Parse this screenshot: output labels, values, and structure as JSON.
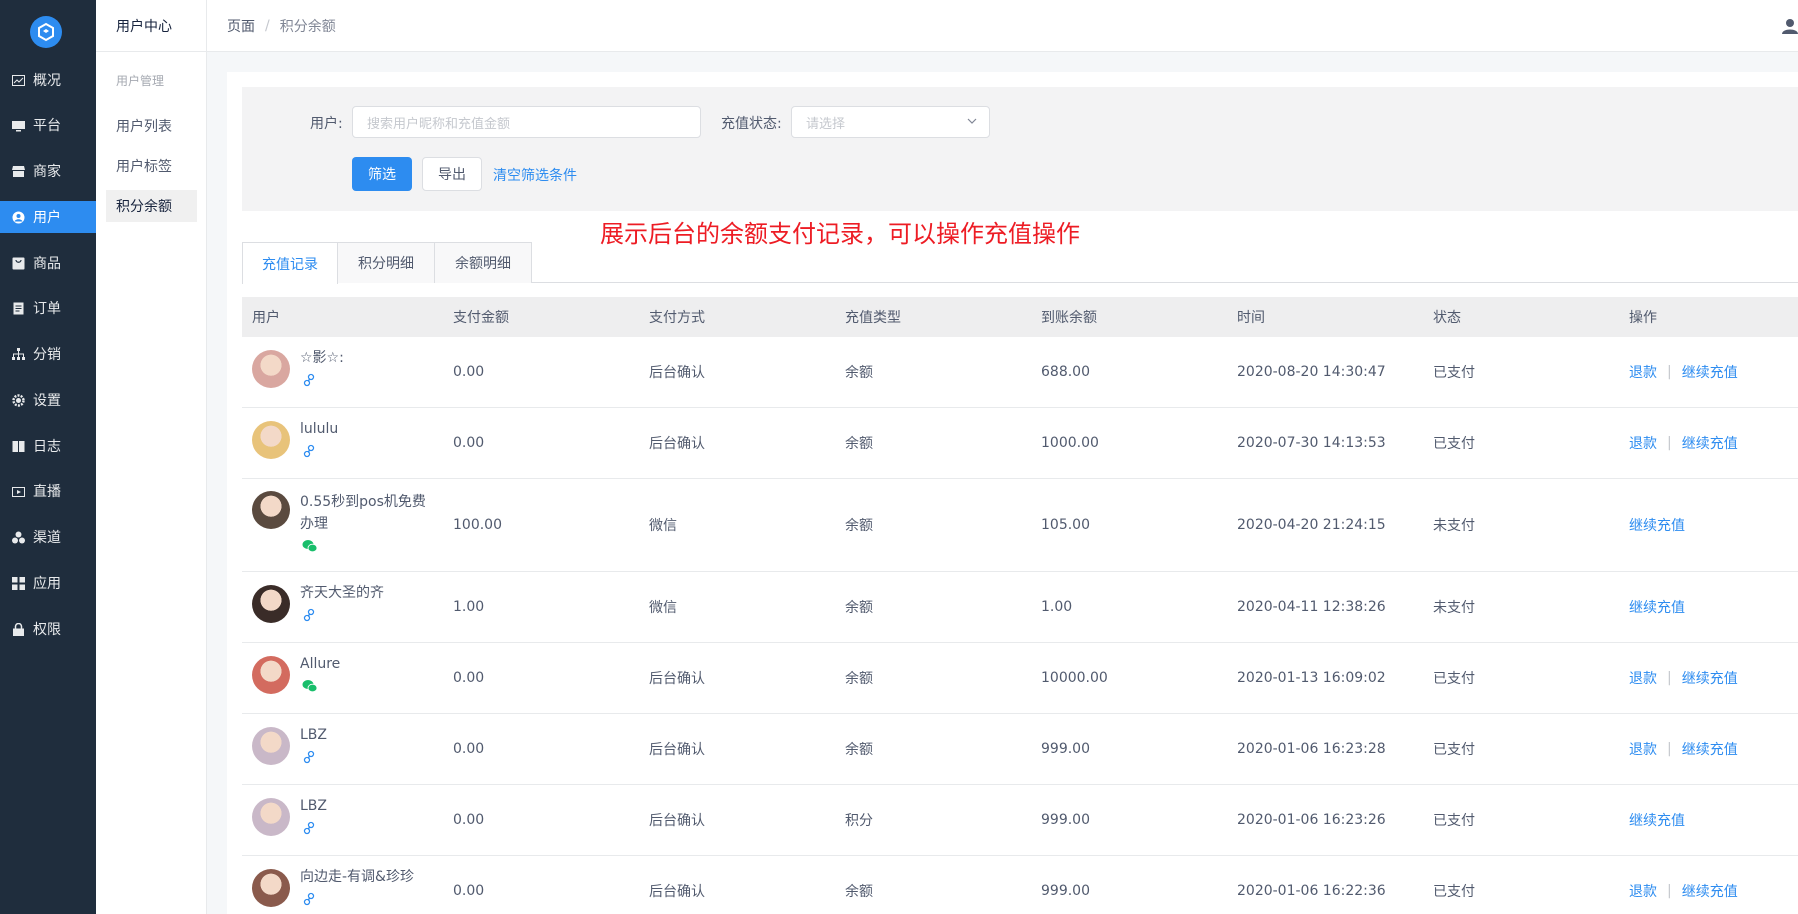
{
  "nav": {
    "items": [
      {
        "label": "概况",
        "icon": "dashboard-icon"
      },
      {
        "label": "平台",
        "icon": "monitor-icon"
      },
      {
        "label": "商家",
        "icon": "store-icon"
      },
      {
        "label": "用户",
        "icon": "user-icon",
        "active": true
      },
      {
        "label": "商品",
        "icon": "goods-icon"
      },
      {
        "label": "订单",
        "icon": "order-icon"
      },
      {
        "label": "分销",
        "icon": "distribution-icon"
      },
      {
        "label": "设置",
        "icon": "gear-icon"
      },
      {
        "label": "日志",
        "icon": "book-icon"
      },
      {
        "label": "直播",
        "icon": "live-icon"
      },
      {
        "label": "渠道",
        "icon": "channel-icon"
      },
      {
        "label": "应用",
        "icon": "apps-icon"
      },
      {
        "label": "权限",
        "icon": "lock-icon"
      }
    ]
  },
  "subnav": {
    "title": "用户中心",
    "group": "用户管理",
    "items": [
      "用户列表",
      "用户标签",
      "积分余额"
    ]
  },
  "header": {
    "crumb_root": "页面",
    "crumb_sep": "/",
    "crumb_current": "积分余额"
  },
  "filter": {
    "user_label": "用户:",
    "user_placeholder": "搜索用户昵称和充值金额",
    "status_label": "充值状态:",
    "status_placeholder": "请选择",
    "filter_btn": "筛选",
    "export_btn": "导出",
    "clear_link": "清空筛选条件"
  },
  "annotation": "展示后台的余额支付记录，可以操作充值操作",
  "tabs": [
    "充值记录",
    "积分明细",
    "余额明细"
  ],
  "table": {
    "headers": [
      "用户",
      "支付金额",
      "支付方式",
      "充值类型",
      "到账余额",
      "时间",
      "状态",
      "操作"
    ],
    "refund_label": "退款",
    "continue_label": "继续充值",
    "op_sep": "|",
    "rows": [
      {
        "user": "☆影☆:",
        "source": "link",
        "amount": "0.00",
        "method": "后台确认",
        "type": "余额",
        "balance": "688.00",
        "time": "2020-08-20 14:30:47",
        "status": "已支付",
        "refund": true,
        "avatar": "#d9a7a0"
      },
      {
        "user": "lululu",
        "source": "link",
        "amount": "0.00",
        "method": "后台确认",
        "type": "余额",
        "balance": "1000.00",
        "time": "2020-07-30 14:13:53",
        "status": "已支付",
        "refund": true,
        "avatar": "#e8c37a"
      },
      {
        "user": "0.55秒到pos机免费办理",
        "source": "wechat",
        "amount": "100.00",
        "method": "微信",
        "type": "余额",
        "balance": "105.00",
        "time": "2020-04-20 21:24:15",
        "status": "未支付",
        "refund": false,
        "avatar": "#5a4a3f"
      },
      {
        "user": "齐天大圣的齐",
        "source": "link",
        "amount": "1.00",
        "method": "微信",
        "type": "余额",
        "balance": "1.00",
        "time": "2020-04-11 12:38:26",
        "status": "未支付",
        "refund": false,
        "avatar": "#3a2c28"
      },
      {
        "user": "Allure",
        "source": "wechat",
        "amount": "0.00",
        "method": "后台确认",
        "type": "余额",
        "balance": "10000.00",
        "time": "2020-01-13 16:09:02",
        "status": "已支付",
        "refund": true,
        "avatar": "#d36b5f"
      },
      {
        "user": "LBZ",
        "source": "link",
        "amount": "0.00",
        "method": "后台确认",
        "type": "余额",
        "balance": "999.00",
        "time": "2020-01-06 16:23:28",
        "status": "已支付",
        "refund": true,
        "avatar": "#c9b8c8"
      },
      {
        "user": "LBZ",
        "source": "link",
        "amount": "0.00",
        "method": "后台确认",
        "type": "积分",
        "balance": "999.00",
        "time": "2020-01-06 16:23:26",
        "status": "已支付",
        "refund": false,
        "avatar": "#c9b8c8"
      },
      {
        "user": "向边走-有调&珍珍",
        "source": "link",
        "amount": "0.00",
        "method": "后台确认",
        "type": "余额",
        "balance": "999.00",
        "time": "2020-01-06 16:22:36",
        "status": "已支付",
        "refund": true,
        "avatar": "#8a5a4c"
      }
    ]
  }
}
